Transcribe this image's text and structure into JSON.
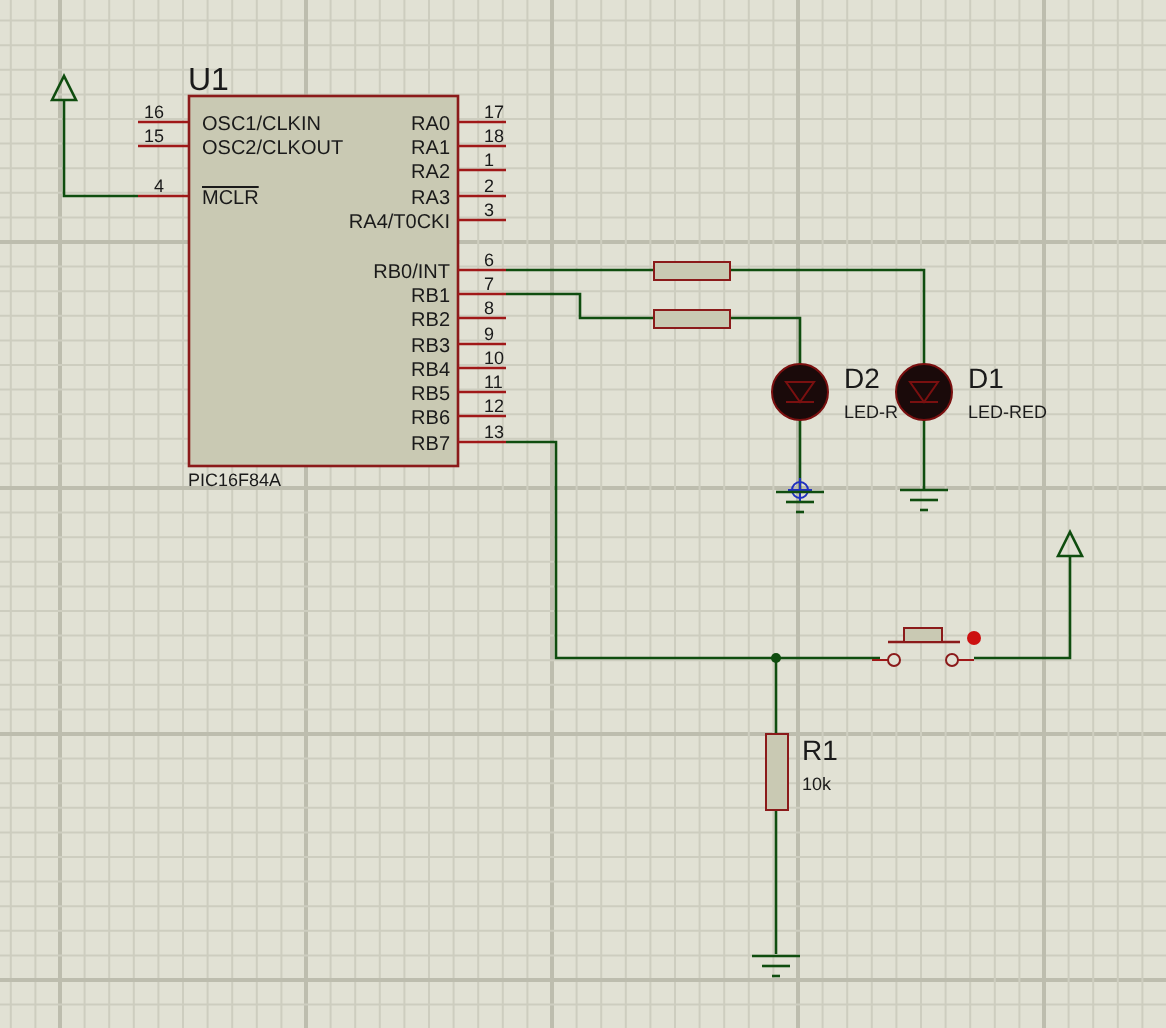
{
  "schematic": {
    "chip": {
      "ref": "U1",
      "part": "PIC16F84A",
      "left_pins": [
        {
          "number": "16",
          "name": "OSC1/CLKIN",
          "inverted": false
        },
        {
          "number": "15",
          "name": "OSC2/CLKOUT",
          "inverted": false
        },
        {
          "number": "4",
          "name": "MCLR",
          "inverted": true
        }
      ],
      "right_pins": [
        {
          "number": "17",
          "name": "RA0"
        },
        {
          "number": "18",
          "name": "RA1"
        },
        {
          "number": "1",
          "name": "RA2"
        },
        {
          "number": "2",
          "name": "RA3"
        },
        {
          "number": "3",
          "name": "RA4/T0CKI"
        },
        {
          "number": "6",
          "name": "RB0/INT"
        },
        {
          "number": "7",
          "name": "RB1"
        },
        {
          "number": "8",
          "name": "RB2"
        },
        {
          "number": "9",
          "name": "RB3"
        },
        {
          "number": "10",
          "name": "RB4"
        },
        {
          "number": "11",
          "name": "RB5"
        },
        {
          "number": "12",
          "name": "RB6"
        },
        {
          "number": "13",
          "name": "RB7"
        }
      ]
    },
    "leds": [
      {
        "ref": "D2",
        "value": "LED-R"
      },
      {
        "ref": "D1",
        "value": "LED-RED"
      }
    ],
    "switch": {
      "closed": false
    },
    "resistor": {
      "ref": "R1",
      "value": "10k"
    }
  }
}
